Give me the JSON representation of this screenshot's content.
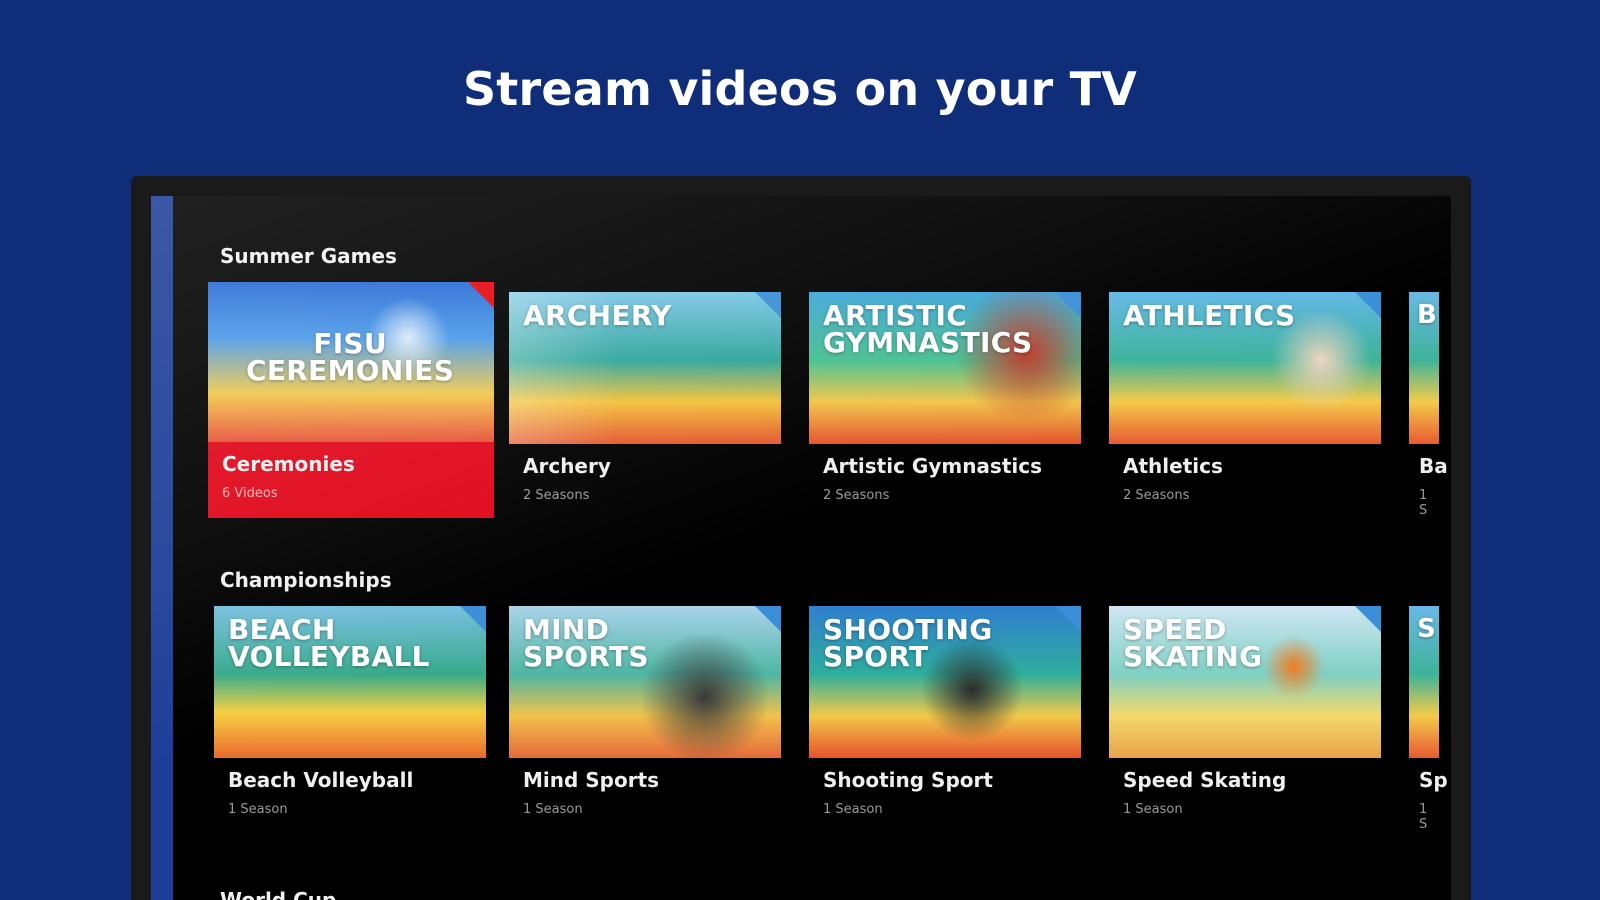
{
  "headline": "Stream videos on your TV",
  "colors": {
    "page_background": "#0f2d78",
    "focus_accent": "#e0071a",
    "corner_badge": "#3b8fd8"
  },
  "sections": [
    {
      "title": "Summer Games",
      "cards": [
        {
          "thumb_text": "FISU\nCEREMONIES",
          "name": "Ceremonies",
          "meta": "6 Videos",
          "focused": true
        },
        {
          "thumb_text": "ARCHERY",
          "name": "Archery",
          "meta": "2 Seasons"
        },
        {
          "thumb_text": "ARTISTIC\nGYMNASTICS",
          "name": "Artistic Gymnastics",
          "meta": "2 Seasons"
        },
        {
          "thumb_text": "ATHLETICS",
          "name": "Athletics",
          "meta": "2 Seasons"
        },
        {
          "thumb_text": "B",
          "name": "Ba",
          "meta": "1 S"
        }
      ]
    },
    {
      "title": "Championships",
      "cards": [
        {
          "thumb_text": "BEACH\nVOLLEYBALL",
          "name": "Beach Volleyball",
          "meta": "1 Season"
        },
        {
          "thumb_text": "MIND\nSPORTS",
          "name": "Mind Sports",
          "meta": "1 Season"
        },
        {
          "thumb_text": "SHOOTING\nSPORT",
          "name": "Shooting Sport",
          "meta": "1 Season"
        },
        {
          "thumb_text": "SPEED\nSKATING",
          "name": "Speed Skating",
          "meta": "1 Season"
        },
        {
          "thumb_text": "S",
          "name": "Sp",
          "meta": "1 S"
        }
      ]
    },
    {
      "title": "World Cup"
    }
  ]
}
